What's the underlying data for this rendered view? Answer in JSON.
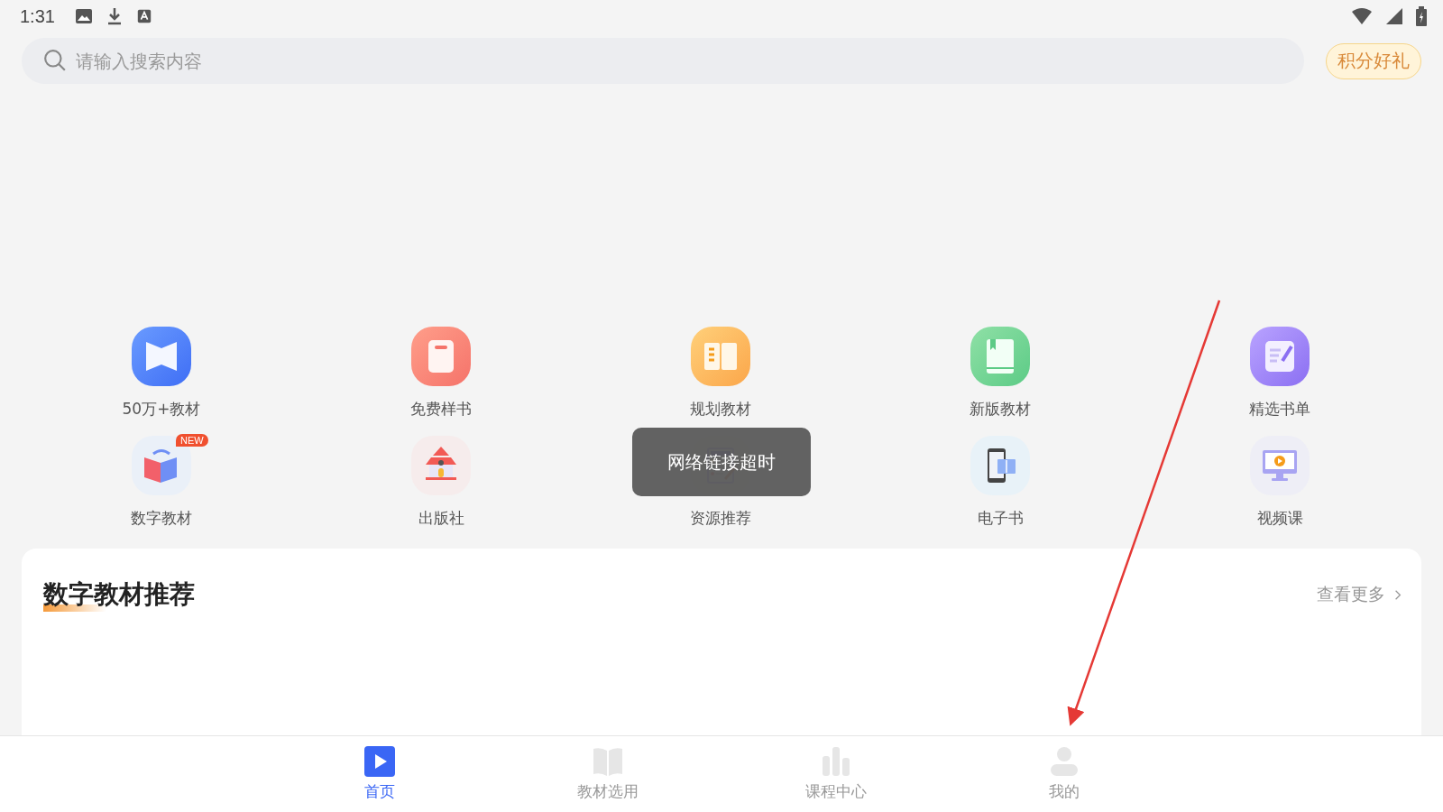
{
  "status_bar": {
    "time": "1:31"
  },
  "search": {
    "placeholder": "请输入搜索内容"
  },
  "points_button": "积分好礼",
  "categories": [
    {
      "label": "50万+教材"
    },
    {
      "label": "免费样书"
    },
    {
      "label": "规划教材"
    },
    {
      "label": "新版教材"
    },
    {
      "label": "精选书单"
    },
    {
      "label": "数字教材",
      "badge": "NEW"
    },
    {
      "label": "出版社"
    },
    {
      "label": "资源推荐"
    },
    {
      "label": "电子书"
    },
    {
      "label": "视频课"
    }
  ],
  "toast": "网络链接超时",
  "section": {
    "title": "数字教材推荐",
    "more": "查看更多"
  },
  "bottom_nav": [
    {
      "label": "首页",
      "selected": true
    },
    {
      "label": "教材选用",
      "selected": false
    },
    {
      "label": "课程中心",
      "selected": false
    },
    {
      "label": "我的",
      "selected": false
    }
  ]
}
